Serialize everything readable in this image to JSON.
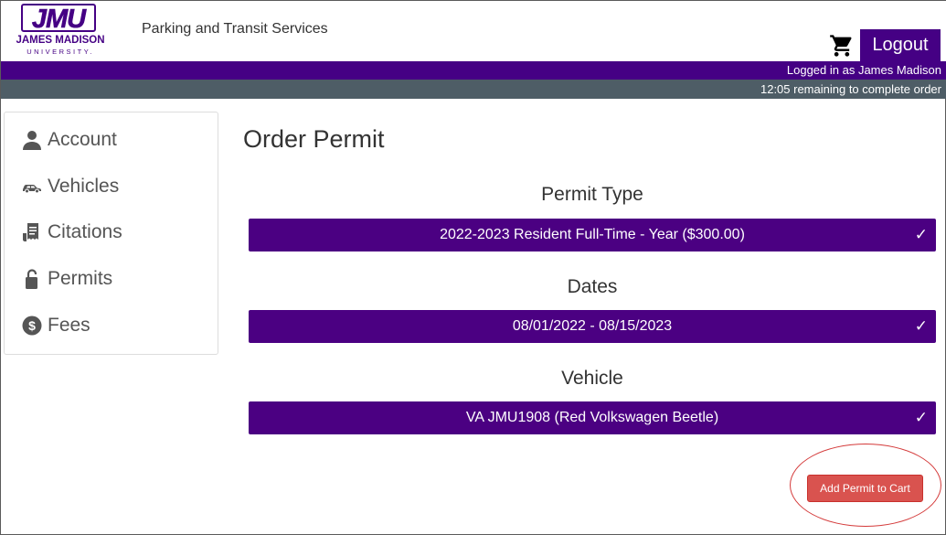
{
  "header": {
    "logo_mark": "JMU",
    "logo_name": "JAMES MADISON",
    "logo_sub": "UNIVERSITY.",
    "site_title": "Parking and Transit Services",
    "cart_icon": "shopping-cart-icon",
    "logout_label": "Logout"
  },
  "status": {
    "logged_in": "Logged in as James Madison",
    "timer": "12:05 remaining to complete order"
  },
  "sidebar": {
    "items": [
      {
        "label": "Account",
        "icon": "person-icon"
      },
      {
        "label": "Vehicles",
        "icon": "car-icon"
      },
      {
        "label": "Citations",
        "icon": "ticket-icon"
      },
      {
        "label": "Permits",
        "icon": "lock-icon"
      },
      {
        "label": "Fees",
        "icon": "dollar-icon"
      }
    ]
  },
  "main": {
    "title": "Order Permit",
    "permit_type_label": "Permit Type",
    "permit_type_value": "2022-2023 Resident Full-Time - Year ($300.00)",
    "dates_label": "Dates",
    "dates_value": "08/01/2022 - 08/15/2023",
    "vehicle_label": "Vehicle",
    "vehicle_value": "VA JMU1908 (Red Volkswagen Beetle)",
    "check_mark": "✓",
    "add_button": "Add Permit to Cart"
  },
  "colors": {
    "brand_purple": "#450084",
    "status_gray": "#4e5d66",
    "button_red": "#d9534f",
    "highlight_ring": "#d43a3a"
  }
}
